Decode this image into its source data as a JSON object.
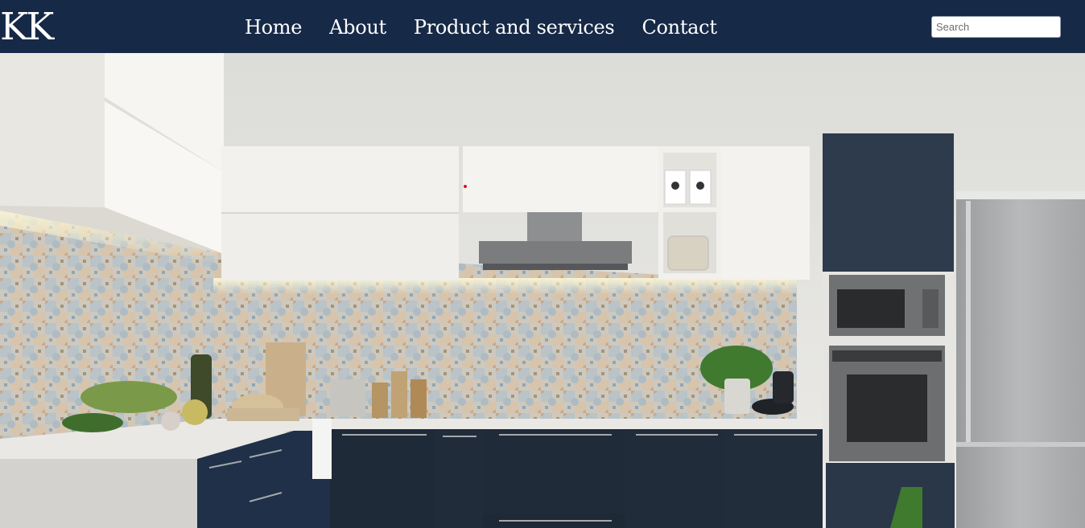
{
  "brand": {
    "logo_text": "KK"
  },
  "nav": {
    "items": [
      {
        "label": "Home"
      },
      {
        "label": "About"
      },
      {
        "label": "Product and services"
      },
      {
        "label": "Contact"
      }
    ]
  },
  "search": {
    "placeholder": "Search",
    "value": ""
  },
  "hero": {
    "subject": "modern kitchen with navy base cabinets, white upper cabinets, patterned tile backsplash and built-in ovens"
  },
  "colors": {
    "header_bg": "#162947",
    "header_text": "#ffffff",
    "cabinet_navy": "#27354a",
    "cabinet_white": "#f1efec"
  },
  "icons": [
    "kitchen-hero-image"
  ]
}
